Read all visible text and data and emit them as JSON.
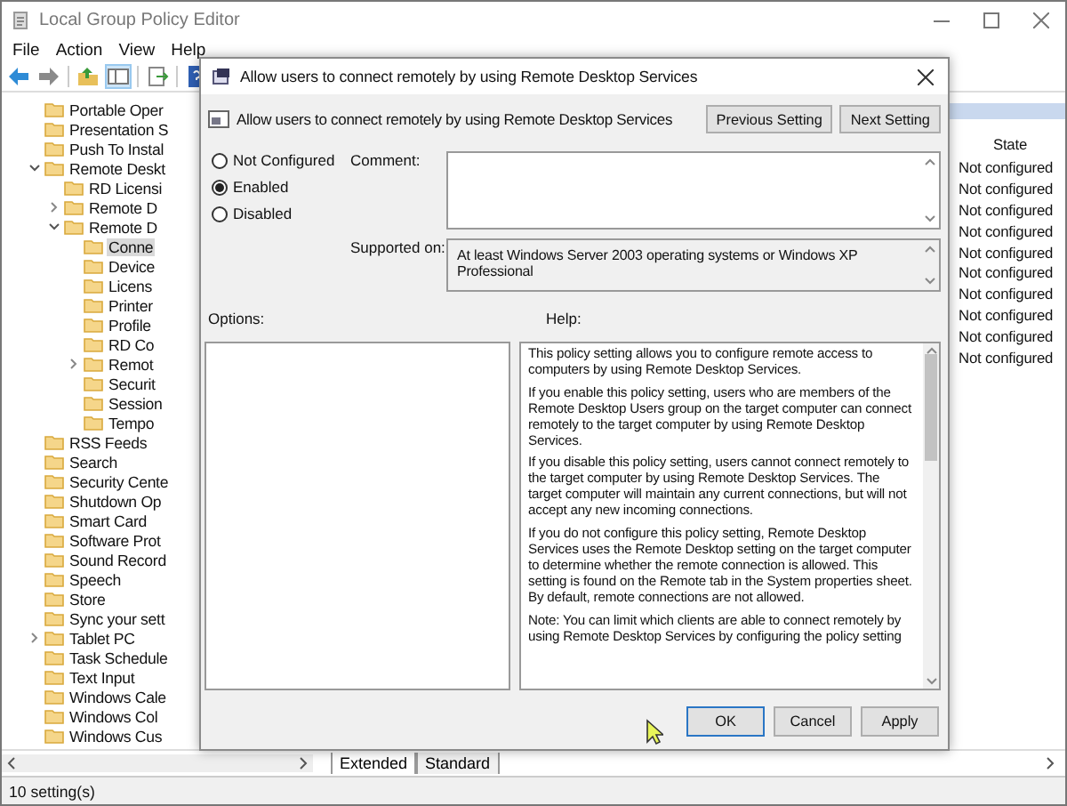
{
  "window": {
    "title": "Local Group Policy Editor"
  },
  "menu": [
    "File",
    "Action",
    "View",
    "Help"
  ],
  "tree": [
    {
      "label": "Portable Oper",
      "selected": false
    },
    {
      "label": "Presentation S",
      "selected": false
    },
    {
      "label": "Push To Instal",
      "selected": false
    },
    {
      "label": "Remote Deskt",
      "selected": false,
      "expanded": true,
      "children": [
        {
          "label": "RD Licensi",
          "selected": false
        },
        {
          "label": "Remote D",
          "selected": false,
          "expanded": false
        },
        {
          "label": "Remote D",
          "selected": false,
          "expanded": true,
          "children": [
            {
              "label": "Conne",
              "selected": true
            },
            {
              "label": "Device",
              "selected": false
            },
            {
              "label": "Licens",
              "selected": false
            },
            {
              "label": "Printer",
              "selected": false
            },
            {
              "label": "Profile",
              "selected": false
            },
            {
              "label": "RD Co",
              "selected": false
            },
            {
              "label": "Remot",
              "selected": false,
              "expanded": false
            },
            {
              "label": "Securit",
              "selected": false
            },
            {
              "label": "Session",
              "selected": false
            },
            {
              "label": "Tempo",
              "selected": false
            }
          ]
        }
      ]
    },
    {
      "label": "RSS Feeds",
      "selected": false
    },
    {
      "label": "Search",
      "selected": false
    },
    {
      "label": "Security Cente",
      "selected": false
    },
    {
      "label": "Shutdown Op",
      "selected": false
    },
    {
      "label": "Smart Card",
      "selected": false
    },
    {
      "label": "Software Prot",
      "selected": false
    },
    {
      "label": "Sound Record",
      "selected": false
    },
    {
      "label": "Speech",
      "selected": false
    },
    {
      "label": "Store",
      "selected": false
    },
    {
      "label": "Sync your sett",
      "selected": false
    },
    {
      "label": "Tablet PC",
      "selected": false,
      "expanded": false
    },
    {
      "label": "Task Schedule",
      "selected": false
    },
    {
      "label": "Text Input",
      "selected": false
    },
    {
      "label": "Windows Cale",
      "selected": false
    },
    {
      "label": "Windows Col",
      "selected": false
    },
    {
      "label": "Windows Cus",
      "selected": false
    }
  ],
  "list": {
    "column_header": "State",
    "rows": [
      "Not configured",
      "Not configured",
      "Not configured",
      "Not configured",
      "Not configured",
      "Not configured",
      "Not configured",
      "Not configured",
      "Not configured",
      "Not configured"
    ]
  },
  "view_tabs": [
    {
      "label": "Extended",
      "selected": true
    },
    {
      "label": "Standard",
      "selected": false
    }
  ],
  "status_bar": "10 setting(s)",
  "dialog": {
    "title": "Allow users to connect remotely by using Remote Desktop Services",
    "heading": "Allow users to connect remotely by using Remote Desktop Services",
    "nav_buttons": [
      "Previous Setting",
      "Next Setting"
    ],
    "states": [
      {
        "label": "Not Configured",
        "selected": false
      },
      {
        "label": "Enabled",
        "selected": true
      },
      {
        "label": "Disabled",
        "selected": false
      }
    ],
    "comment_label": "Comment:",
    "supported_label": "Supported on:",
    "supported_text": "At least Windows Server 2003 operating systems or Windows XP Professional",
    "options_label": "Options:",
    "help_label": "Help:",
    "help": [
      "This policy setting allows you to configure remote access to computers by using Remote Desktop Services.",
      "If you enable this policy setting, users who are members of the Remote Desktop Users group on the target computer can connect remotely to the target computer by using Remote Desktop Services.",
      "If you disable this policy setting, users cannot connect remotely to the target computer by using Remote Desktop Services. The target computer will maintain any current connections, but will not accept any new incoming connections.",
      "If you do not configure this policy setting, Remote Desktop Services uses the Remote Desktop setting on the target computer to determine whether the remote connection is allowed. This setting is found on the Remote tab in the System properties sheet. By default, remote connections are not allowed.",
      "Note: You can limit which clients are able to connect remotely by using Remote Desktop Services by configuring the policy setting"
    ],
    "buttons": [
      {
        "label": "OK",
        "default": true
      },
      {
        "label": "Cancel",
        "default": false
      },
      {
        "label": "Apply",
        "default": false
      }
    ]
  }
}
